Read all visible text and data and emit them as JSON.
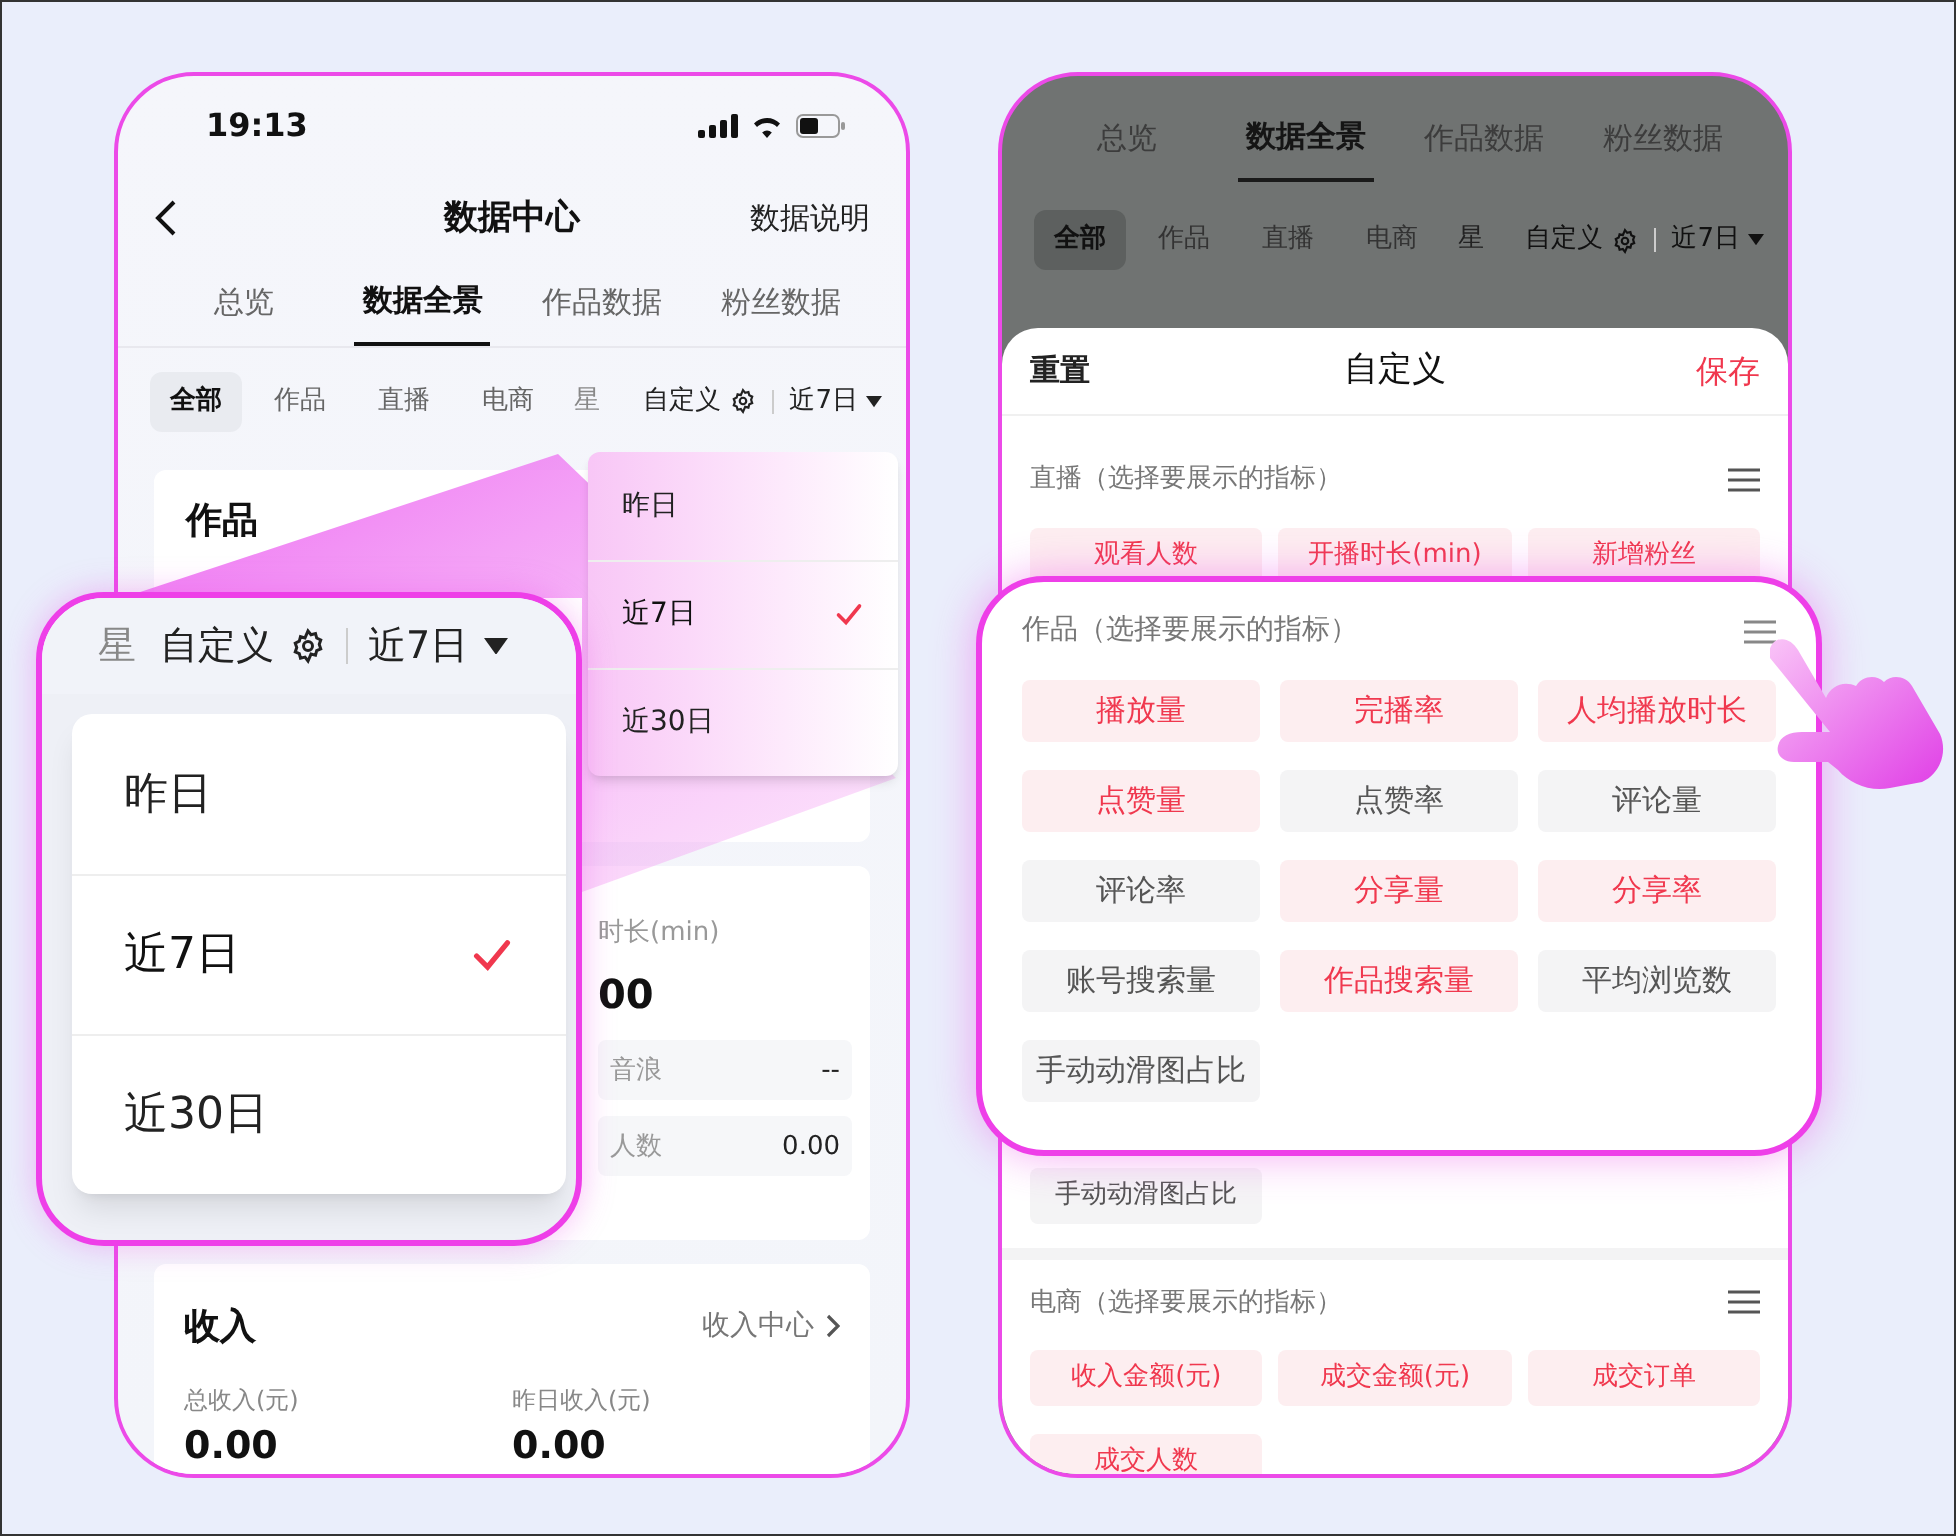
{
  "left_phone": {
    "status_bar": {
      "time": "19:13"
    },
    "nav": {
      "title": "数据中心",
      "action": "数据说明"
    },
    "tabs": [
      {
        "label": "总览",
        "selected": false
      },
      {
        "label": "数据全景",
        "selected": true
      },
      {
        "label": "作品数据",
        "selected": false
      },
      {
        "label": "粉丝数据",
        "selected": false
      }
    ],
    "filters": [
      {
        "label": "全部",
        "selected": true
      },
      {
        "label": "作品",
        "selected": false
      },
      {
        "label": "直播",
        "selected": false
      },
      {
        "label": "电商",
        "selected": false
      }
    ],
    "clipped_filter": "星",
    "custom_label": "自定义",
    "range_label": "近7日",
    "dropdown": [
      {
        "label": "昨日",
        "selected": false
      },
      {
        "label": "近7日",
        "selected": true
      },
      {
        "label": "近30日",
        "selected": false
      }
    ],
    "works_card": {
      "title": "作品"
    },
    "live_card": {
      "metric_label": "时长(min)",
      "metric_value": "00",
      "rows": [
        {
          "label": "音浪",
          "value": "--"
        },
        {
          "label": "人数",
          "value": "0.00"
        }
      ]
    },
    "income_card": {
      "title": "收入",
      "link": "收入中心",
      "metrics": [
        {
          "label": "总收入(元)",
          "value": "0.00"
        },
        {
          "label": "昨日收入(元)",
          "value": "0.00"
        }
      ]
    }
  },
  "left_callout": {
    "clipped_filter": "星",
    "custom_label": "自定义",
    "range_label": "近7日",
    "dropdown": [
      {
        "label": "昨日",
        "selected": false
      },
      {
        "label": "近7日",
        "selected": true
      },
      {
        "label": "近30日",
        "selected": false
      }
    ]
  },
  "right_phone": {
    "tabs": [
      {
        "label": "总览",
        "selected": false
      },
      {
        "label": "数据全景",
        "selected": true
      },
      {
        "label": "作品数据",
        "selected": false
      },
      {
        "label": "粉丝数据",
        "selected": false
      }
    ],
    "filters": [
      {
        "label": "全部",
        "selected": true
      },
      {
        "label": "作品",
        "selected": false
      },
      {
        "label": "直播",
        "selected": false
      },
      {
        "label": "电商",
        "selected": false
      }
    ],
    "clipped_filter": "星",
    "custom_label": "自定义",
    "range_label": "近7日",
    "sheet": {
      "reset": "重置",
      "title": "自定义",
      "save": "保存",
      "live_section": {
        "title": "直播（选择要展示的指标）",
        "chips": [
          {
            "label": "观看人数",
            "selected": true
          },
          {
            "label": "开播时长(min)",
            "selected": true
          },
          {
            "label": "新增粉丝",
            "selected": true
          }
        ]
      },
      "works_tail_chip": {
        "label": "手动动滑图占比",
        "selected": false
      },
      "commerce_section": {
        "title": "电商（选择要展示的指标）",
        "chips": [
          {
            "label": "收入金额(元)",
            "selected": true
          },
          {
            "label": "成交金额(元)",
            "selected": true
          },
          {
            "label": "成交订单",
            "selected": true
          },
          {
            "label": "成交人数",
            "selected": true
          }
        ]
      }
    }
  },
  "right_callout": {
    "title": "作品（选择要展示的指标）",
    "chips": [
      {
        "label": "播放量",
        "selected": true
      },
      {
        "label": "完播率",
        "selected": true
      },
      {
        "label": "人均播放时长",
        "selected": true
      },
      {
        "label": "点赞量",
        "selected": true
      },
      {
        "label": "点赞率",
        "selected": false
      },
      {
        "label": "评论量",
        "selected": false
      },
      {
        "label": "评论率",
        "selected": false
      },
      {
        "label": "分享量",
        "selected": true
      },
      {
        "label": "分享率",
        "selected": true
      },
      {
        "label": "账号搜索量",
        "selected": false
      },
      {
        "label": "作品搜索量",
        "selected": true
      },
      {
        "label": "平均浏览数",
        "selected": false
      },
      {
        "label": "手动动滑图占比",
        "selected": false
      }
    ]
  }
}
